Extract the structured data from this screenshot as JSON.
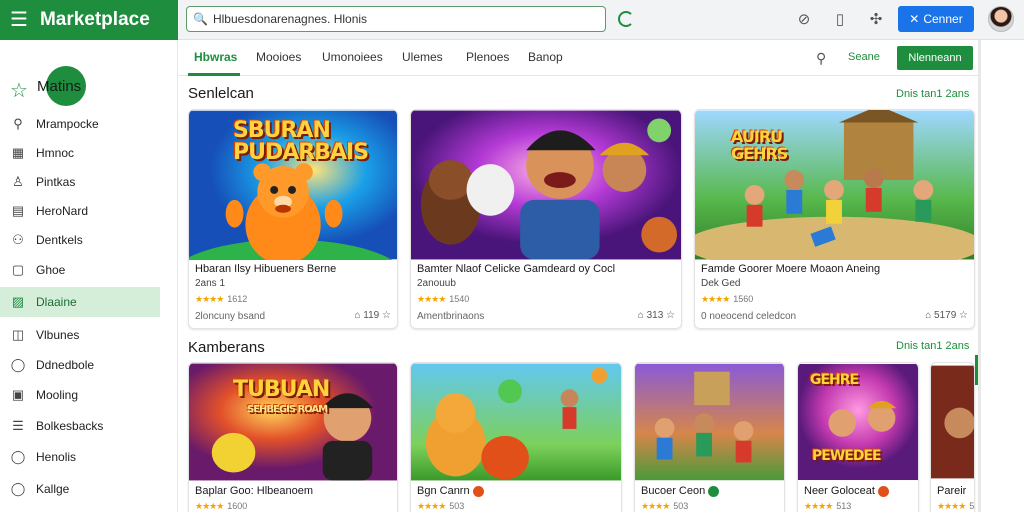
{
  "app": {
    "title": "Marketplace"
  },
  "search": {
    "value": "Hlbuesdonarenagnes. Hlonis"
  },
  "header": {
    "connect_label": "Cenner"
  },
  "sidebar": {
    "logo_text": "Matins",
    "items": [
      {
        "label": "Mrampocke"
      },
      {
        "label": "Hmnoc"
      },
      {
        "label": "Pintkas"
      },
      {
        "label": "HeroNard"
      },
      {
        "label": "Dentkels"
      },
      {
        "label": "Ghoe"
      },
      {
        "label": "Dlaaine"
      },
      {
        "label": "Vlbunes"
      },
      {
        "label": "Ddnedbole"
      },
      {
        "label": "Mooling"
      },
      {
        "label": "Bolkesbacks"
      },
      {
        "label": "Henolis"
      },
      {
        "label": "Kallge"
      }
    ]
  },
  "tabs": [
    {
      "label": "Hbwras"
    },
    {
      "label": "Mooioes"
    },
    {
      "label": "Umonoiees"
    },
    {
      "label": "Ulemes"
    },
    {
      "label": "Plenoes"
    },
    {
      "label": "Banop"
    }
  ],
  "toolbar": {
    "link": "Seane",
    "manage_label": "Nlenneann"
  },
  "sections": [
    {
      "title": "Senlelcan",
      "see_all": "Dnis tan1 2ans",
      "cards": [
        {
          "art_title": "SBURAN PUDARBAIS",
          "title": "Hbaran Ilsy Hibueners Berne",
          "subtitle": "2ans 1",
          "stars": "★★★★",
          "rating": "1612",
          "footer": "2loncuny bsand",
          "actions": "⌂  119  ☆"
        },
        {
          "art_title": "",
          "title": "Bamter Nlaof Celicke Gamdeard oy Cocl",
          "subtitle": "2anouub",
          "stars": "★★★★",
          "rating": "1540",
          "footer": "Amentbrinaons",
          "actions": "⌂  313  ☆"
        },
        {
          "art_title": "AUIRU GEHRS",
          "title": "Famde Goorer Moere Moaon Aneing",
          "subtitle": "Dek Ged",
          "stars": "★★★★",
          "rating": "1560",
          "footer": "0 noeocend celedcon",
          "actions": "⌂  5179  ☆"
        }
      ]
    },
    {
      "title": "Kamberans",
      "see_all": "Dnis tan1 2ans",
      "cards": [
        {
          "art_title": "TUBUAN",
          "art_sub": "SEHBEGIS ROAM",
          "title": "Baplar Goo: Hlbeanoem",
          "stars": "★★★★",
          "rating": "1600"
        },
        {
          "title": "Bgn Canrn",
          "stars": "★★★★",
          "rating": "503"
        },
        {
          "title": "Bucoer Ceon",
          "stars": "★★★★",
          "rating": "503"
        },
        {
          "art_title": "GEHRE",
          "art_sub": "PEWEDEE",
          "title": "Neer Goloceat",
          "stars": "★★★★",
          "rating": "513"
        },
        {
          "title": "Pareir",
          "stars": "★★★★",
          "rating": "5"
        }
      ]
    }
  ],
  "colors": {
    "brand": "#1e8e3e",
    "accent": "#1a73e8",
    "star": "#f4a400",
    "active_bg": "#d5eed9"
  },
  "icons": [
    "menu-icon",
    "search-icon",
    "refresh-icon",
    "explore-icon",
    "tablet-icon",
    "puzzle-icon",
    "bookmark-icon",
    "star-icon"
  ]
}
